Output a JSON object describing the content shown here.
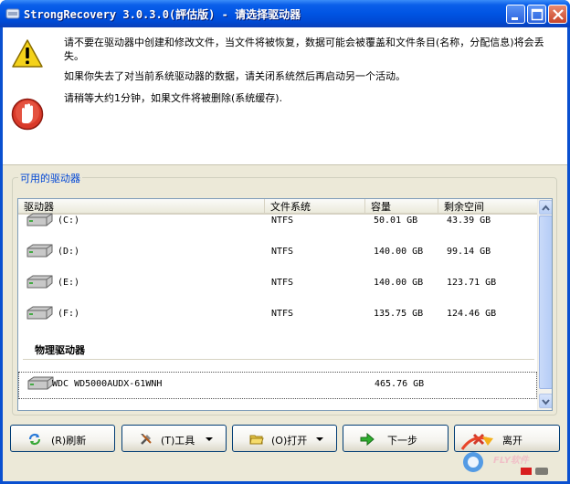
{
  "window": {
    "title": "StrongRecovery 3.0.3.0(評估版) - 请选择驱动器"
  },
  "messages": {
    "warning_line1": "请不要在驱动器中创建和修改文件，当文件将被恢复，数据可能会被覆盖和文件条目(名称，分配信息)将会丢失。",
    "warning_line2": "如果你失去了对当前系统驱动器的数据，请关闭系统然后再启动另一个活动。",
    "warning_line3": "请稍等大约1分钟，如果文件将被删除(系统缓存)."
  },
  "drives_group": {
    "label": "可用的驱动器",
    "columns": [
      "驱动器",
      "文件系统",
      "容量",
      "剩余空间"
    ],
    "logical": [
      {
        "name": "(C:)",
        "fs": "NTFS",
        "capacity": "50.01 GB",
        "free": "43.39 GB"
      },
      {
        "name": "(D:)",
        "fs": "NTFS",
        "capacity": "140.00 GB",
        "free": "99.14 GB"
      },
      {
        "name": "(E:)",
        "fs": "NTFS",
        "capacity": "140.00 GB",
        "free": "123.71 GB"
      },
      {
        "name": "(F:)",
        "fs": "NTFS",
        "capacity": "135.75 GB",
        "free": "124.46 GB"
      }
    ],
    "physical_title": "物理驱动器",
    "physical": [
      {
        "name": "WDC WD5000AUDX-61WNH",
        "fs": "",
        "capacity": "465.76 GB",
        "free": ""
      }
    ]
  },
  "buttons": {
    "refresh": "(R)刷新",
    "tools": "(T)工具",
    "open": "(O)打开",
    "next": "下一步",
    "exit": "离开"
  },
  "watermark": {
    "text": "FLY软件"
  },
  "colors": {
    "titlebar": "#0054e3",
    "group_label": "#0046d5",
    "dialog_bg": "#ece9d8"
  }
}
